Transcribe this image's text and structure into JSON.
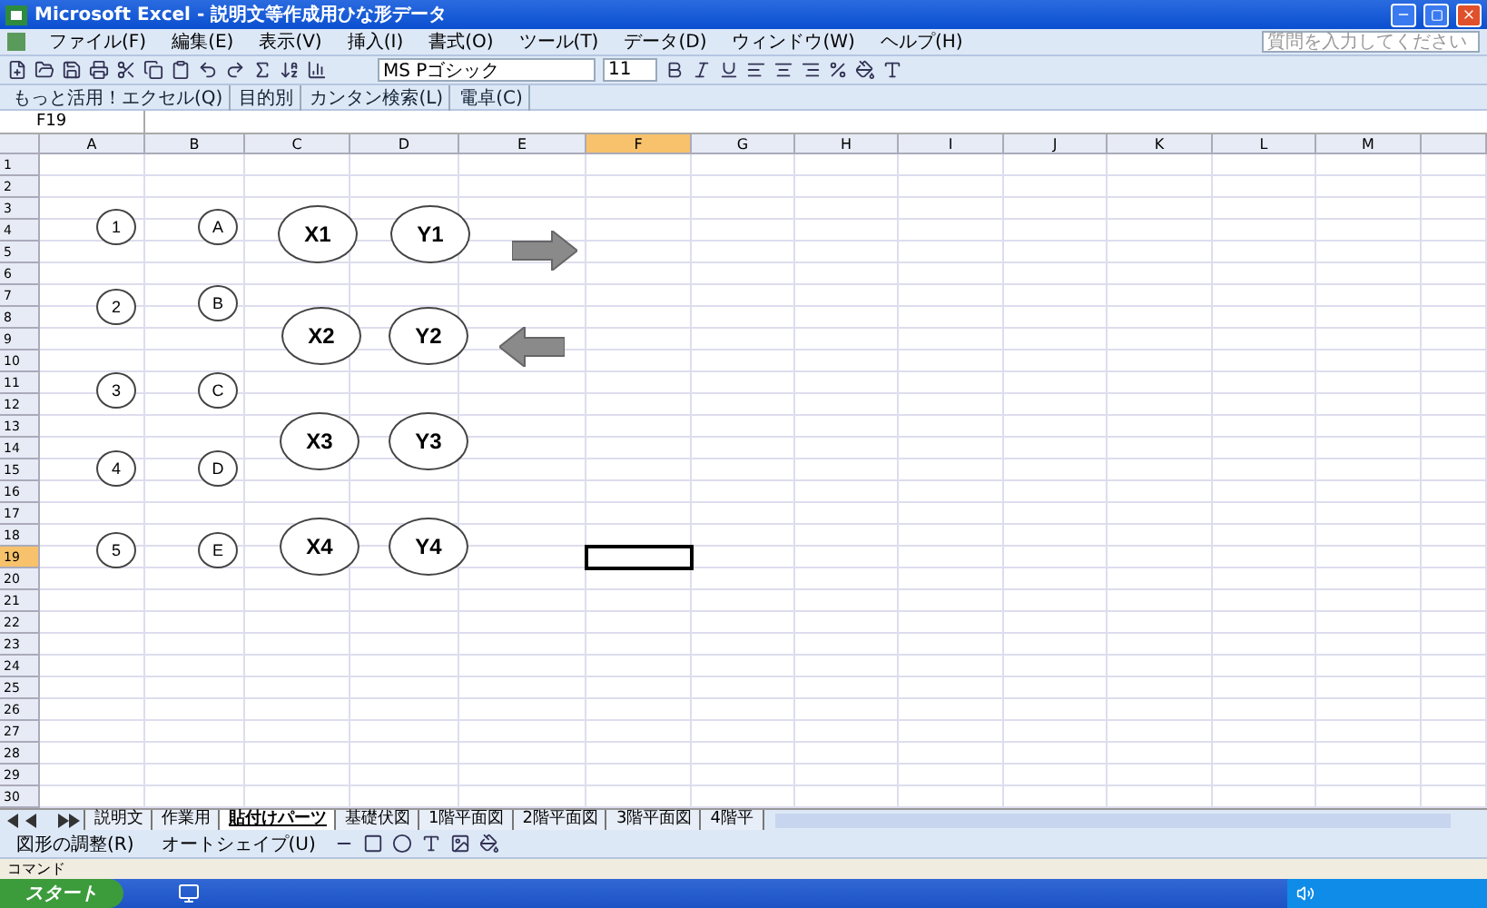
{
  "window": {
    "title": "Microsoft Excel - 説明文等作成用ひな形データ"
  },
  "menu": [
    "ファイル(F)",
    "編集(E)",
    "表示(V)",
    "挿入(I)",
    "書式(O)",
    "ツール(T)",
    "データ(D)",
    "ウィンドウ(W)",
    "ヘルプ(H)"
  ],
  "help_box": {
    "placeholder": "質問を入力してください"
  },
  "format_toolbar": {
    "font": "MS Pゴシック",
    "size": "11"
  },
  "links_toolbar": [
    "もっと活用！エクセル(Q)",
    "目的別",
    "カンタン検索(L)",
    "電卓(C)"
  ],
  "name_box": {
    "value": "F19"
  },
  "columns": [
    {
      "label": "A",
      "selected": false
    },
    {
      "label": "B",
      "selected": false
    },
    {
      "label": "C",
      "selected": false
    },
    {
      "label": "D",
      "selected": false
    },
    {
      "label": "E",
      "selected": false
    },
    {
      "label": "F",
      "selected": true
    },
    {
      "label": "G",
      "selected": false
    },
    {
      "label": "H",
      "selected": false
    },
    {
      "label": "I",
      "selected": false
    },
    {
      "label": "J",
      "selected": false
    },
    {
      "label": "K",
      "selected": false
    },
    {
      "label": "L",
      "selected": false
    },
    {
      "label": "M",
      "selected": false
    }
  ],
  "rows": [
    {
      "label": "1",
      "selected": false
    },
    {
      "label": "2",
      "selected": false
    },
    {
      "label": "3",
      "selected": false
    },
    {
      "label": "4",
      "selected": false
    },
    {
      "label": "5",
      "selected": false
    },
    {
      "label": "6",
      "selected": false
    },
    {
      "label": "7",
      "selected": false
    },
    {
      "label": "8",
      "selected": false
    },
    {
      "label": "9",
      "selected": false
    },
    {
      "label": "10",
      "selected": false
    },
    {
      "label": "11",
      "selected": false
    },
    {
      "label": "12",
      "selected": false
    },
    {
      "label": "13",
      "selected": false
    },
    {
      "label": "14",
      "selected": false
    },
    {
      "label": "15",
      "selected": false
    },
    {
      "label": "16",
      "selected": false
    },
    {
      "label": "17",
      "selected": false
    },
    {
      "label": "18",
      "selected": false
    },
    {
      "label": "19",
      "selected": true
    },
    {
      "label": "20",
      "selected": false
    },
    {
      "label": "21",
      "selected": false
    },
    {
      "label": "22",
      "selected": false
    },
    {
      "label": "23",
      "selected": false
    },
    {
      "label": "24",
      "selected": false
    },
    {
      "label": "25",
      "selected": false
    },
    {
      "label": "26",
      "selected": false
    },
    {
      "label": "27",
      "selected": false
    },
    {
      "label": "28",
      "selected": false
    },
    {
      "label": "29",
      "selected": false
    },
    {
      "label": "30",
      "selected": false
    }
  ],
  "shapes": [
    {
      "kind": "circle",
      "label": "1"
    },
    {
      "kind": "circle",
      "label": "2"
    },
    {
      "kind": "circle",
      "label": "3"
    },
    {
      "kind": "circle",
      "label": "4"
    },
    {
      "kind": "circle",
      "label": "5"
    },
    {
      "kind": "circle",
      "label": "A"
    },
    {
      "kind": "circle",
      "label": "B"
    },
    {
      "kind": "circle",
      "label": "C"
    },
    {
      "kind": "circle",
      "label": "D"
    },
    {
      "kind": "circle",
      "label": "E"
    },
    {
      "kind": "ellipse",
      "label": "X1"
    },
    {
      "kind": "ellipse",
      "label": "X2"
    },
    {
      "kind": "ellipse",
      "label": "X3"
    },
    {
      "kind": "ellipse",
      "label": "X4"
    },
    {
      "kind": "ellipse",
      "label": "Y1"
    },
    {
      "kind": "ellipse",
      "label": "Y2"
    },
    {
      "kind": "ellipse",
      "label": "Y3"
    },
    {
      "kind": "ellipse",
      "label": "Y4"
    },
    {
      "kind": "arrow_right"
    },
    {
      "kind": "arrow_left"
    }
  ],
  "sheet_tabs": [
    {
      "label": "説明文",
      "selected": false
    },
    {
      "label": "作業用",
      "selected": false
    },
    {
      "label": "貼付けパーツ",
      "selected": true
    },
    {
      "label": "基礎伏図",
      "selected": false
    },
    {
      "label": "1階平面図",
      "selected": false
    },
    {
      "label": "2階平面図",
      "selected": false
    },
    {
      "label": "3階平面図",
      "selected": false
    },
    {
      "label": "4階平",
      "selected": false
    }
  ],
  "drawing_toolbar": [
    "図形の調整(R)",
    "オートシェイプ(U)"
  ],
  "status_bar": "コマンド",
  "taskbar": {
    "start": "スタート"
  }
}
